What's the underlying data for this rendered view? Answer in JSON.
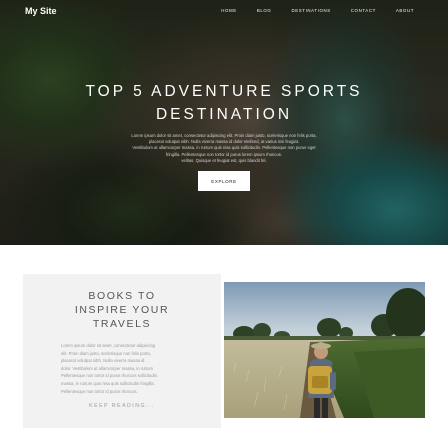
{
  "site": {
    "logo": "My Site"
  },
  "nav": {
    "items": [
      "HOME",
      "BLOG",
      "DESTINATIONS",
      "CONTACT",
      "ABOUT"
    ]
  },
  "hero": {
    "title_line1": "TOP 5 ADVENTURE SPORTS",
    "title_line2": "DESTINATION",
    "subtitle_lines": [
      "Lorem ipsum dolor sit amet, consectetur adipiscing elit. Proin diam justo, scelerisque non felis porta,",
      "placerat volutpat nibh. Nulla viverra massa id dolor eleifend, at varius nisi feugiat.",
      "Vestibulum at ullamcorper massa, in rutrum quis nisa quis sollicitudin. Pellentesque non purus eget",
      "fringilla. Pellentesque non tortor id purus lorem ipsum rhoncus.",
      "velitas. Quisque et feugiat est, quis blandit fel."
    ],
    "button_label": "EXPLORE"
  },
  "feature": {
    "title_line1": "BOOKS TO",
    "title_line2": "INSPIRE YOUR",
    "title_line3": "TRAVELS",
    "body_lines": [
      "Lorem ipsum dolor sit amet, consectetur adipiscing",
      "elit. Proin diam justo, scelerisque non felis porta,",
      "placerat volutpat nibh. Nulla viverra massa id",
      "dolor. Vestibulum at ullamcorper massa, in rutrum",
      "Pellentesque non tortor id purus rhoncus sollicitudin.",
      "massa, in rutrum quis nisa quis sollicitudin fringilla.",
      "Pellentesque non tortor id purus rhoncus."
    ],
    "link_label": "KEEP READING..."
  },
  "colors": {
    "hero_overlay": "#000000",
    "card_bg": "#f2f2f2",
    "button_bg": "#ffffff",
    "text_muted": "#9a9a9a",
    "title_gray": "#555555"
  },
  "icons": {
    "photo": "hiker-in-field-photo"
  }
}
